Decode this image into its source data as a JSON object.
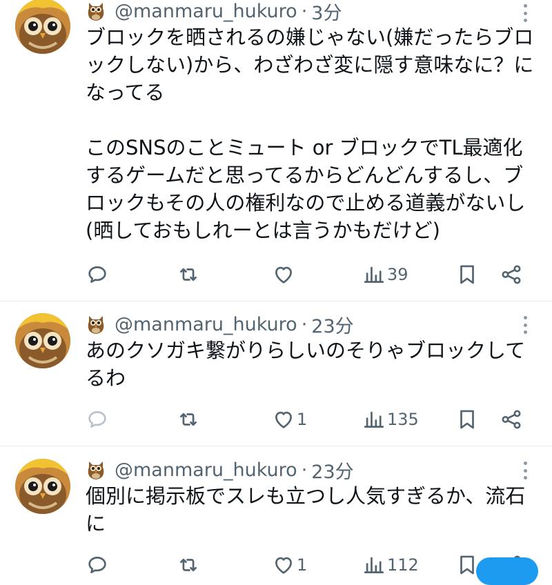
{
  "tweets": [
    {
      "handle": "@manmaru_hukuro",
      "separator": "·",
      "time": "3分",
      "text": "ブロックを晒されるの嫌じゃない(嫌だったらブロックしない)から、わざわざ変に隠す意味なに？になってる\n\nこのSNSのことミュート or ブロックでTL最適化するゲームだと思ってるからどんどんするし、ブロックもその人の権利なので止める道義がないし(晒しておもしれーとは言うかもだけど)",
      "replies": "",
      "retweets": "",
      "likes": "",
      "views": "39"
    },
    {
      "handle": "@manmaru_hukuro",
      "separator": "·",
      "time": "23分",
      "text": "あのクソガキ繋がりらしいのそりゃブロックしてるわ",
      "replies": "",
      "retweets": "",
      "likes": "1",
      "views": "135"
    },
    {
      "handle": "@manmaru_hukuro",
      "separator": "·",
      "time": "23分",
      "text": "個別に掲示板でスレも立つし人気すぎるか、流石に",
      "replies": "",
      "retweets": "",
      "likes": "1",
      "views": "112"
    }
  ],
  "colors": {
    "text": "#0f1419",
    "secondary": "#536471",
    "divider": "#e7e9ea",
    "accent": "#1d9bf0"
  },
  "icons": {
    "reply": "reply-icon",
    "retweet": "retweet-icon",
    "like": "heart-icon",
    "views": "views-icon",
    "bookmark": "bookmark-icon",
    "share": "share-icon",
    "more": "more-icon",
    "author_emoji": "owl-emoji-icon"
  }
}
